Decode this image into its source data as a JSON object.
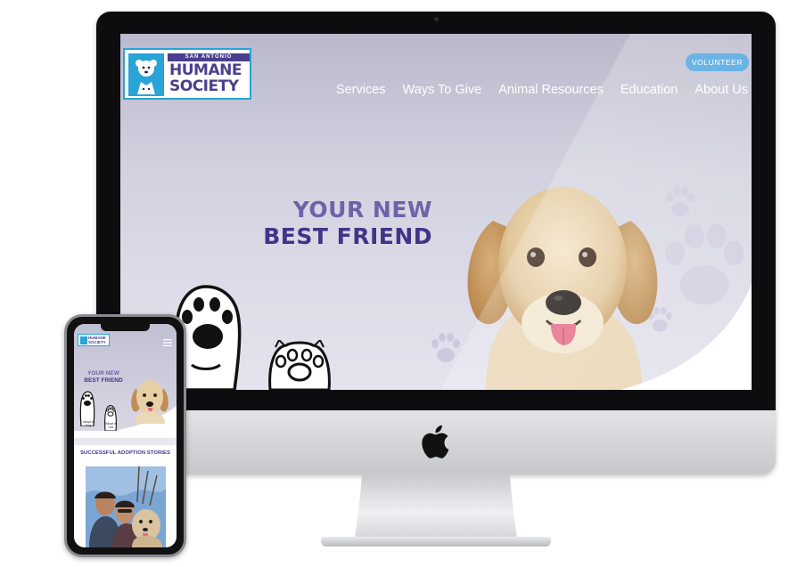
{
  "desktop": {
    "logo": {
      "top_text": "SAN ANTONIO",
      "line1": "HUMANE",
      "line2": "SOCIETY"
    },
    "volunteer_button": "VOLUNTEER",
    "nav": [
      {
        "label": "Services"
      },
      {
        "label": "Ways To Give"
      },
      {
        "label": "Animal Resources"
      },
      {
        "label": "Education"
      },
      {
        "label": "About Us"
      }
    ],
    "hero": {
      "line1": "YOUR NEW",
      "line2": "BEST FRIEND"
    }
  },
  "mobile": {
    "logo": {
      "line1": "HUMANE",
      "line2": "SOCIETY"
    },
    "hero": {
      "line1": "YOUR NEW",
      "line2": "BEST FRIEND"
    },
    "caption_adopt": "Adopt a Dog",
    "caption_cat": "Adopt a Cat",
    "section_title": "SUCCESSFUL ADOPTION STORIES"
  },
  "colors": {
    "brand_purple": "#3f3588",
    "brand_light_purple": "#6e63a8",
    "brand_blue": "#2aa3d6",
    "volunteer_blue": "#4aa3e0",
    "hero_bg": "#d2d1df"
  },
  "icons": [
    "apple-icon",
    "paw-icon",
    "cat-paw-icon",
    "hamburger-menu-icon",
    "humane-society-logo-icon"
  ]
}
